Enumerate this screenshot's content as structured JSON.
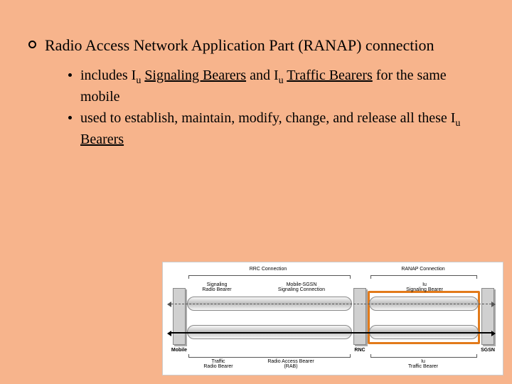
{
  "main_bullet": "Radio Access Network Application Part (RANAP) connection",
  "sub": {
    "s1_pre": "includes I",
    "s1_sub1": "u",
    "s1_link1": "Signaling Bearers",
    "s1_mid": " and I",
    "s1_sub2": "u",
    "s1_link2": "Traffic Bearers",
    "s1_post": " for the same mobile",
    "s2_pre": "used to establish, maintain, modify, change, and release all these I",
    "s2_sub": "u",
    "s2_link": "Bearers"
  },
  "diagram": {
    "nodes": {
      "mobile": "Mobile",
      "rnc": "RNC",
      "sgsn": "SGSN"
    },
    "top": {
      "rrc": "RRC Connection",
      "ranap": "RANAP Connection"
    },
    "mid": {
      "sig_radio": "Signaling\nRadio Bearer",
      "mob_sgsn": "Mobile-SGSN\nSignaling Connection",
      "iu_sig": "Iu\nSignaling Bearer"
    },
    "bot": {
      "traf_radio": "Traffic\nRadio Bearer",
      "rab": "Radio Access Bearer\n(RAB)",
      "iu_traf": "Iu\nTraffic Bearer"
    }
  }
}
